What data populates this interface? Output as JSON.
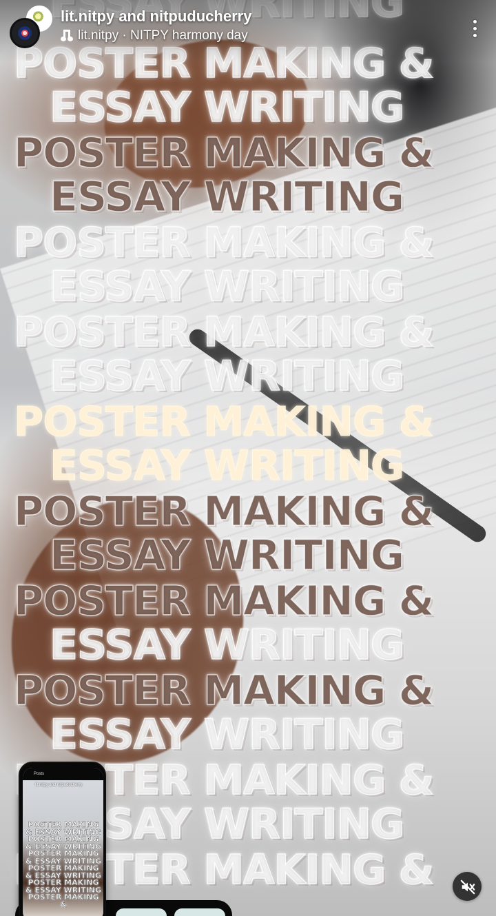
{
  "header": {
    "account_names": "lit.nitpy and nitpuducherry",
    "audio_label": "lit.nitpy · NITPY harmony day"
  },
  "poster": {
    "line_1": "POSTER MAKING &",
    "line_2": "ESSAY WRITING",
    "repetitions": 10
  },
  "preview": {
    "header_text": "Posts",
    "mini_title": "lit.nitpy and nitpuducherry",
    "poster_text": "POSTER MAKING & ESSAY WRITING POSTER MAKING & ESSAY WRITING POSTER MAKING & ESSAY WRITING POSTER MAKING & ESSAY WRITING POSTER MAKING & ESSAY WRITING POSTER MAKING &"
  },
  "icons": {
    "music": "music-note-icon",
    "more": "more-vertical-icon",
    "mute": "muted-speaker-icon"
  },
  "colors": {
    "overlay_text": "#ffffff",
    "mute_button": "#333333",
    "bottom_pill": "#d7e7e5"
  }
}
